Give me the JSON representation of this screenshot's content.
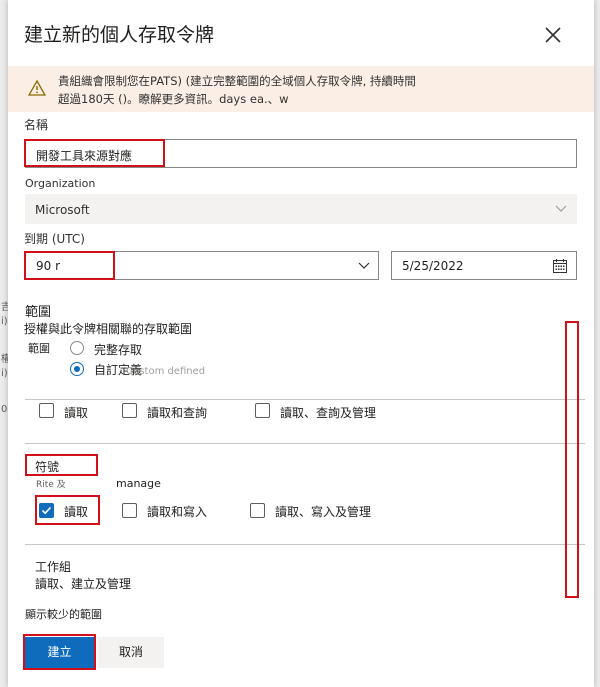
{
  "dialog": {
    "title": "建立新的個人存取令牌",
    "banner": {
      "line1": "貴組織會限制您在PATS) (建立完整範圍的全域個人存取令牌, 持續時間",
      "line2": "超過180天 ()。瞭解更多資訊。days ea.、w"
    },
    "name": {
      "label": "名稱",
      "value": "開發工具來源對應"
    },
    "organization": {
      "label": "Organization",
      "value": "Microsoft"
    },
    "expiration": {
      "label": "到期 (UTC)",
      "value": "90 r",
      "date": "5/25/2022"
    },
    "scopes": {
      "heading": "範圍",
      "description": "授權與此令牌相關聯的存取範圍",
      "type_label": "範圍",
      "options": [
        "完整存取",
        "自訂定義"
      ],
      "selected": "自訂定義",
      "ghost_text": "Custom defined"
    },
    "code_row": [
      "讀取",
      "讀取和查詢",
      "讀取、查詢及管理"
    ],
    "symbols": {
      "title": "符號",
      "description_fragment": "Rite 及",
      "description_tail": "manage",
      "options": [
        "讀取",
        "讀取和寫入",
        "讀取、寫入及管理"
      ],
      "checked": "讀取"
    },
    "work_items": {
      "title": "工作組",
      "description": "讀取、建立及管理"
    },
    "show_fewer": "顯示較少的範圍",
    "buttons": {
      "create": "建立",
      "cancel": "取消"
    }
  },
  "colors": {
    "accent": "#0f6cbd",
    "highlight": "#d1101a",
    "banner_bg": "#fbeee5"
  },
  "left_edge_fragments": [
    "吉",
    "i)",
    "權",
    "i)",
    "0"
  ]
}
